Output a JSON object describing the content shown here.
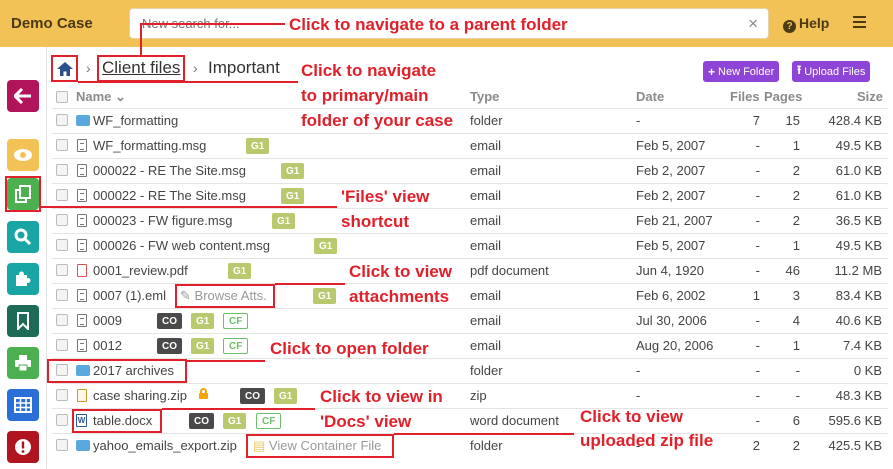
{
  "app": {
    "title": "Demo Case"
  },
  "search": {
    "placeholder": "New search for...",
    "clear_symbol": "×"
  },
  "header": {
    "help_label": "Help"
  },
  "breadcrumb": {
    "parent": "Client files",
    "separator": "›",
    "current": "Important"
  },
  "toolbar": {
    "new_folder_label": "New Folder",
    "upload_files_label": "Upload Files"
  },
  "columns": {
    "name": "Name",
    "type": "Type",
    "date": "Date",
    "files": "Files",
    "pages": "Pages",
    "size": "Size"
  },
  "rows": [
    {
      "name": "WF_formatting",
      "type": "folder",
      "date": "-",
      "files": "7",
      "pages": "15",
      "size": "428.4 KB"
    },
    {
      "name": "WF_formatting.msg",
      "type": "email",
      "date": "Feb 5, 2007",
      "files": "-",
      "pages": "1",
      "size": "49.5 KB"
    },
    {
      "name": "000022 - RE The Site.msg",
      "type": "email",
      "date": "Feb 2, 2007",
      "files": "-",
      "pages": "2",
      "size": "61.0 KB"
    },
    {
      "name": "000022 - RE The Site.msg",
      "type": "email",
      "date": "Feb 2, 2007",
      "files": "-",
      "pages": "2",
      "size": "61.0 KB"
    },
    {
      "name": "000023 - FW figure.msg",
      "type": "email",
      "date": "Feb 21, 2007",
      "files": "-",
      "pages": "2",
      "size": "36.5 KB"
    },
    {
      "name": "000026 - FW web content.msg",
      "type": "email",
      "date": "Feb 5, 2007",
      "files": "-",
      "pages": "1",
      "size": "49.5 KB"
    },
    {
      "name": "0001_review.pdf",
      "type": "pdf document",
      "date": "Jun 4, 1920",
      "files": "-",
      "pages": "46",
      "size": "11.2 MB"
    },
    {
      "name": "0007 (1).eml",
      "type": "email",
      "date": "Feb 6, 2002",
      "files": "1",
      "pages": "3",
      "size": "83.4 KB",
      "action": "Browse Atts."
    },
    {
      "name": "0009",
      "type": "email",
      "date": "Jul 30, 2006",
      "files": "-",
      "pages": "4",
      "size": "40.6 KB"
    },
    {
      "name": "0012",
      "type": "email",
      "date": "Aug 20, 2006",
      "files": "-",
      "pages": "1",
      "size": "7.4 KB"
    },
    {
      "name": "2017 archives",
      "type": "folder",
      "date": "-",
      "files": "-",
      "pages": "-",
      "size": "0 KB"
    },
    {
      "name": "case sharing.zip",
      "type": "zip",
      "date": "-",
      "files": "-",
      "pages": "-",
      "size": "48.3 KB"
    },
    {
      "name": "table.docx",
      "type": "word document",
      "date": "-",
      "files": "-",
      "pages": "6",
      "size": "595.6 KB"
    },
    {
      "name": "yahoo_emails_export.zip",
      "type": "folder",
      "date": "-",
      "files": "2",
      "pages": "2",
      "size": "425.5 KB",
      "action": "View Container File"
    }
  ],
  "badges": {
    "g1": "G1",
    "co": "CO",
    "cf": "CF"
  },
  "annotations": {
    "parent_folder": "Click to navigate to a parent folder",
    "main_folder_1": "Click to navigate",
    "main_folder_2": "to primary/main",
    "main_folder_3": "folder of your case",
    "files_view_1": "'Files' view",
    "files_view_2": "shortcut",
    "attachments_1": "Click to view",
    "attachments_2": "attachments",
    "open_folder": "Click to open folder",
    "docs_view_1": "Click to view in",
    "docs_view_2": "'Docs' view",
    "zip_1": "Click to view",
    "zip_2": "uploaded zip file"
  },
  "colors": {
    "topbar": "#f3c256",
    "annotation": "#e0202a",
    "accent_purple": "#8e44d6"
  },
  "sidebar_icons": [
    "back-arrow-icon",
    "eye-icon",
    "files-icon",
    "search-icon",
    "puzzle-icon",
    "bookmark-icon",
    "print-icon",
    "table-icon",
    "alert-icon"
  ]
}
